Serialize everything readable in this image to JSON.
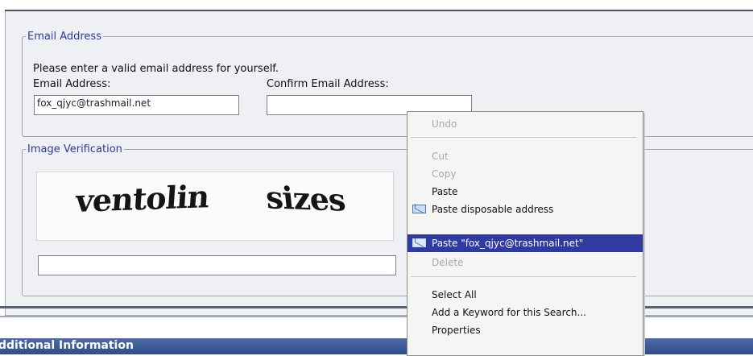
{
  "email_section": {
    "legend": "Email Address",
    "instruction": "Please enter a valid email address for yourself.",
    "email_label": "Email Address:",
    "email_value": "fox_qjyc@trashmail.net",
    "confirm_label": "Confirm Email Address:",
    "confirm_value": ""
  },
  "image_section": {
    "legend": "Image Verification",
    "captcha_words": [
      "ventolin",
      "sizes"
    ],
    "answer_value": ""
  },
  "context_menu": {
    "items": [
      {
        "label": "Undo",
        "state": "disabled"
      },
      {
        "label": "Cut",
        "state": "disabled"
      },
      {
        "label": "Copy",
        "state": "disabled"
      },
      {
        "label": "Paste",
        "state": "enabled"
      },
      {
        "label": "Paste disposable address",
        "state": "enabled",
        "icon": "envelope-icon"
      },
      {
        "label": "Paste \"fox_qjyc@trashmail.net\"",
        "state": "selected",
        "icon": "envelope-icon"
      },
      {
        "label": "Delete",
        "state": "disabled"
      },
      {
        "label": "Select All",
        "state": "enabled"
      },
      {
        "label": "Add a Keyword for this Search...",
        "state": "enabled"
      },
      {
        "label": "Properties",
        "state": "enabled"
      }
    ]
  },
  "additional_section": {
    "title": "dditional Information"
  },
  "colors": {
    "legend_text": "#2c3a9e",
    "menu_highlight": "#2f3aa2",
    "section_bar": "#3a5895"
  }
}
